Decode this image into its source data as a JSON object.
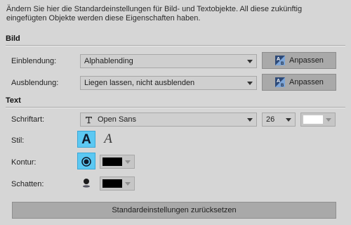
{
  "intro_text": "Ändern Sie hier die Standardeinstellungen für Bild- und Textobjekte. All diese zukünftig eingefügten Objekte werden diese Eigenschaften haben.",
  "bild": {
    "title": "Bild",
    "einblendung": {
      "label": "Einblendung:",
      "value": "Alphablending",
      "button": "Anpassen"
    },
    "ausblendung": {
      "label": "Ausblendung:",
      "value": "Liegen lassen, nicht ausblenden",
      "button": "Anpassen"
    }
  },
  "text": {
    "title": "Text",
    "schriftart": {
      "label": "Schriftart:",
      "value": "Open Sans",
      "size": "26",
      "color": "#ffffff"
    },
    "stil": {
      "label": "Stil:",
      "options": [
        "A",
        "A"
      ],
      "selected": 0
    },
    "kontur": {
      "label": "Kontur:",
      "color": "#000000"
    },
    "schatten": {
      "label": "Schatten:",
      "color": "#000000"
    }
  },
  "reset_button": "Standardeinstellungen zurücksetzen",
  "colors": {
    "background": "#d6d6d6",
    "button": "#a9a9a9",
    "selected_style": "#5cc8f2"
  }
}
